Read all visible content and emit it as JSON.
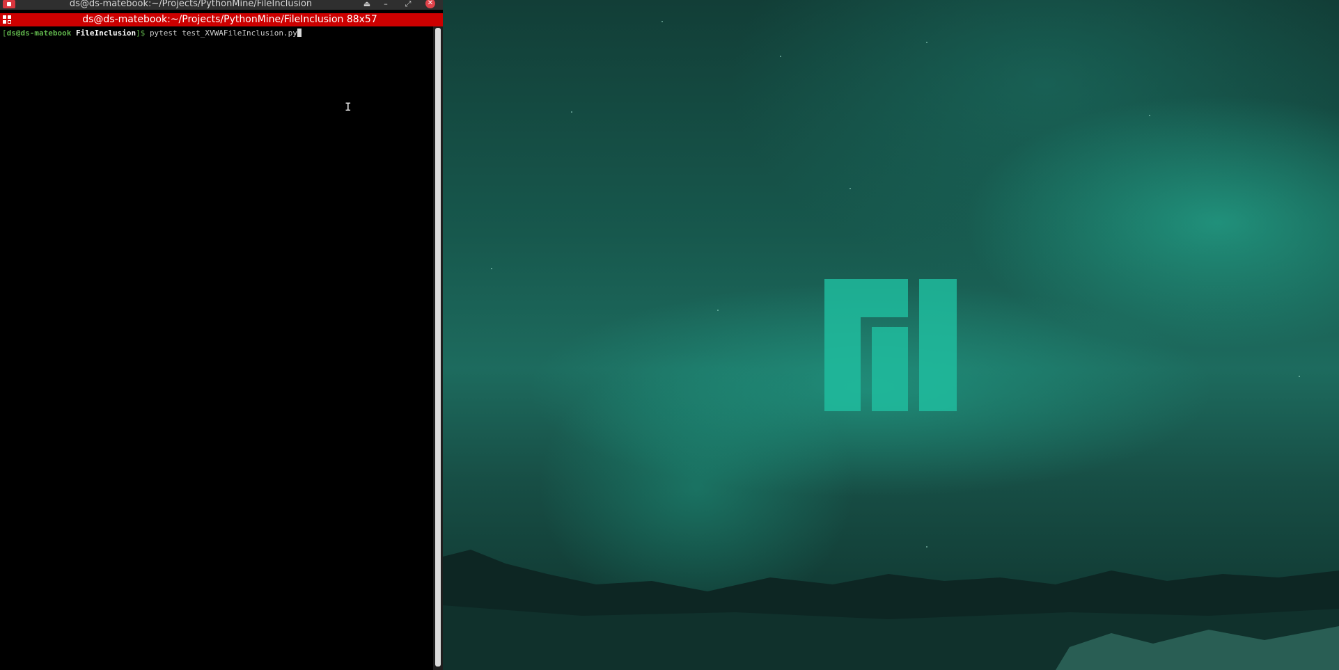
{
  "window": {
    "title": "ds@ds-matebook:~/Projects/PythonMine/FileInclusion",
    "buttons": {
      "shade": "⏏",
      "minimize": "–",
      "maximize": "⤢",
      "close": "✕"
    }
  },
  "terminal": {
    "tab_title": "ds@ds-matebook:~/Projects/PythonMine/FileInclusion 88x57",
    "prompt": {
      "open_bracket": "[",
      "user_host": "ds@ds-matebook",
      "directory": "FileInclusion",
      "close_bracket": "]$"
    },
    "command": "pytest test_XVWAFileInclusion.py"
  },
  "desktop": {
    "wallpaper": "manjaro aurora",
    "accent_color": "#20bea0"
  },
  "colors": {
    "tab_bar": "#cc0000",
    "prompt": "#5fb34b"
  }
}
